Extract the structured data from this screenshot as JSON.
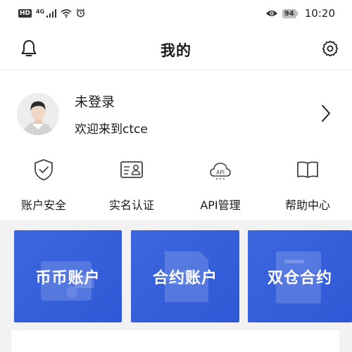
{
  "status_bar": {
    "hd": "HD",
    "network_type": "4G",
    "battery": "94",
    "time": "10:20",
    "icons": [
      "signal-icon",
      "wifi-icon",
      "alarm-icon",
      "eye-icon"
    ]
  },
  "header": {
    "title": "我的",
    "left_icon": "bell-icon",
    "right_icon": "gear-icon"
  },
  "profile": {
    "name": "未登录",
    "subtitle": "欢迎来到ctce",
    "avatar_icon": "user-avatar",
    "arrow_icon": "chevron-right-icon"
  },
  "actions": [
    {
      "label": "账户安全",
      "icon": "shield-check-icon"
    },
    {
      "label": "实名认证",
      "icon": "id-card-icon"
    },
    {
      "label": "API管理",
      "icon": "api-cloud-icon"
    },
    {
      "label": "帮助中心",
      "icon": "book-icon"
    }
  ],
  "accounts": [
    {
      "label": "币币账户",
      "icon": "wallet-icon"
    },
    {
      "label": "合约账户",
      "icon": "document-icon"
    },
    {
      "label": "双仓合约",
      "icon": "contract-icon"
    }
  ],
  "colors": {
    "card_blue": "#3560db",
    "page_gray": "#f2f2f2",
    "text": "#1a1a1a"
  }
}
